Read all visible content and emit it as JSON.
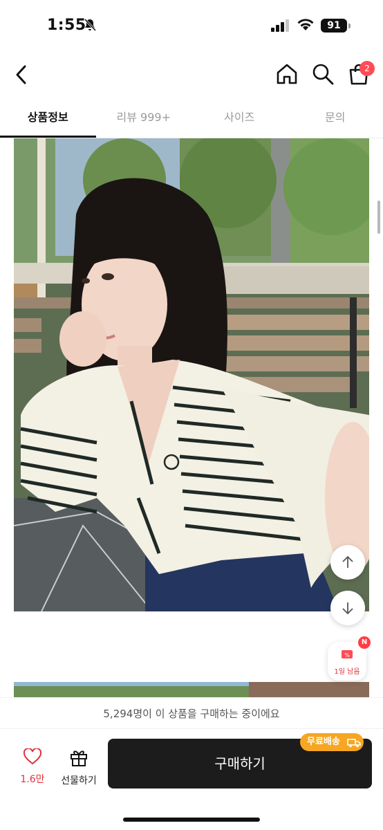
{
  "status_bar": {
    "time": "1:55",
    "battery": "91"
  },
  "nav": {
    "cart_count": "2"
  },
  "tabs": [
    {
      "label": "상품정보",
      "active": true
    },
    {
      "label": "리뷰 999+",
      "active": false
    },
    {
      "label": "사이즈",
      "active": false
    },
    {
      "label": "문의",
      "active": false
    }
  ],
  "coupon": {
    "badge": "N",
    "label": "1일 남음"
  },
  "notice": {
    "buying_text": "5,294명이 이 상품을 구매하는 중이에요"
  },
  "bottom_bar": {
    "like_count": "1.6만",
    "gift_label": "선물하기",
    "buy_label": "구매하기",
    "shipping_badge": "무료배송"
  },
  "colors": {
    "accent_red": "#e0303b",
    "buy_button": "#1c1c1c",
    "shipping_orange": "#f6a623"
  }
}
